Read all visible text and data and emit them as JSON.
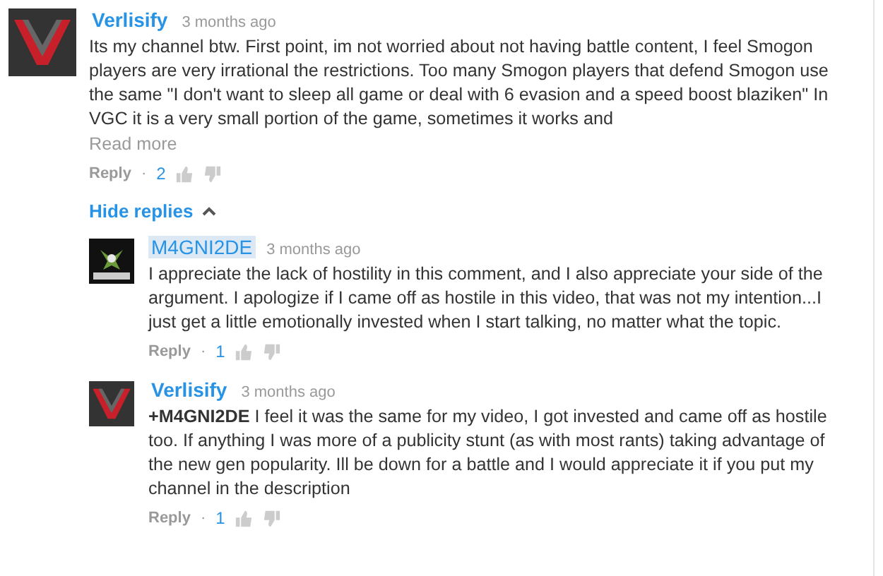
{
  "comment": {
    "author": "Verlisify",
    "highlighted": false,
    "time": "3 months ago",
    "text": "Its my channel btw. First point, im not worried about not having battle content, I feel Smogon players are very irrational the restrictions. Too many Smogon players that defend Smogon use the same \"I don't want to sleep all game or deal with 6 evasion and a speed boost blaziken\" In VGC it is a very small portion of the game, sometimes it works and",
    "kind": "v",
    "read_more": "Read more",
    "reply": "Reply",
    "separator": "·",
    "likes": "2"
  },
  "hide_replies": "Hide replies",
  "replies": [
    {
      "author": "M4GNI2DE",
      "highlighted": true,
      "time": "3 months ago",
      "text": "I appreciate the lack of hostility in this comment, and I also appreciate your side of the argument. I apologize if I came off as hostile in this video, that was not my intention...I just get a little emotionally invested when I start talking, no matter what the topic.",
      "kind": "m",
      "reply": "Reply",
      "separator": "·",
      "likes": "1"
    },
    {
      "author": "Verlisify",
      "highlighted": false,
      "time": "3 months ago",
      "text": "**+M4GNI2DE** I feel it was the same for my video, I got invested and came off as hostile too. If anything I was more of a publicity stunt (as with most rants) taking advantage of the new gen popularity. Ill be down for a battle and I would appreciate it if you put my channel in the description",
      "kind": "v",
      "reply": "Reply",
      "separator": "·",
      "likes": "1"
    }
  ]
}
